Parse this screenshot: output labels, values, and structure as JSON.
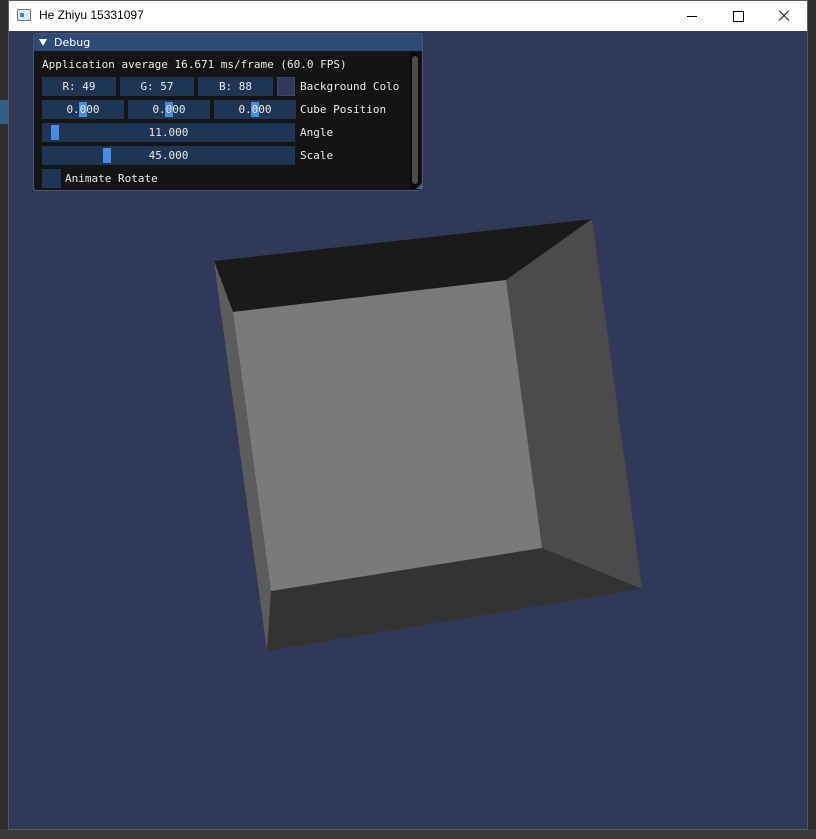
{
  "window": {
    "title": "He Zhiyu 15331097",
    "viewport_color": "#313958"
  },
  "debug": {
    "title": "Debug",
    "fps_text": "Application average 16.671 ms/frame (60.0 FPS)",
    "color": {
      "r_text": "R: 49",
      "g_text": "G: 57",
      "b_text": "B: 88",
      "label": "Background Colo"
    },
    "position": {
      "x": "0.000",
      "y": "0.000",
      "z": "0.000",
      "label": "Cube Position"
    },
    "angle": {
      "value": "11.000",
      "label": "Angle"
    },
    "scale": {
      "value": "45.000",
      "label": "Scale"
    },
    "animate": {
      "label": "Animate Rotate",
      "checked": false
    }
  },
  "cube": {
    "face_colors": {
      "front": "#7a7a7a",
      "top": "#1a1a1a",
      "right": "#4b4b4b",
      "bottom": "#333333",
      "left": "#5c5c5c"
    }
  }
}
